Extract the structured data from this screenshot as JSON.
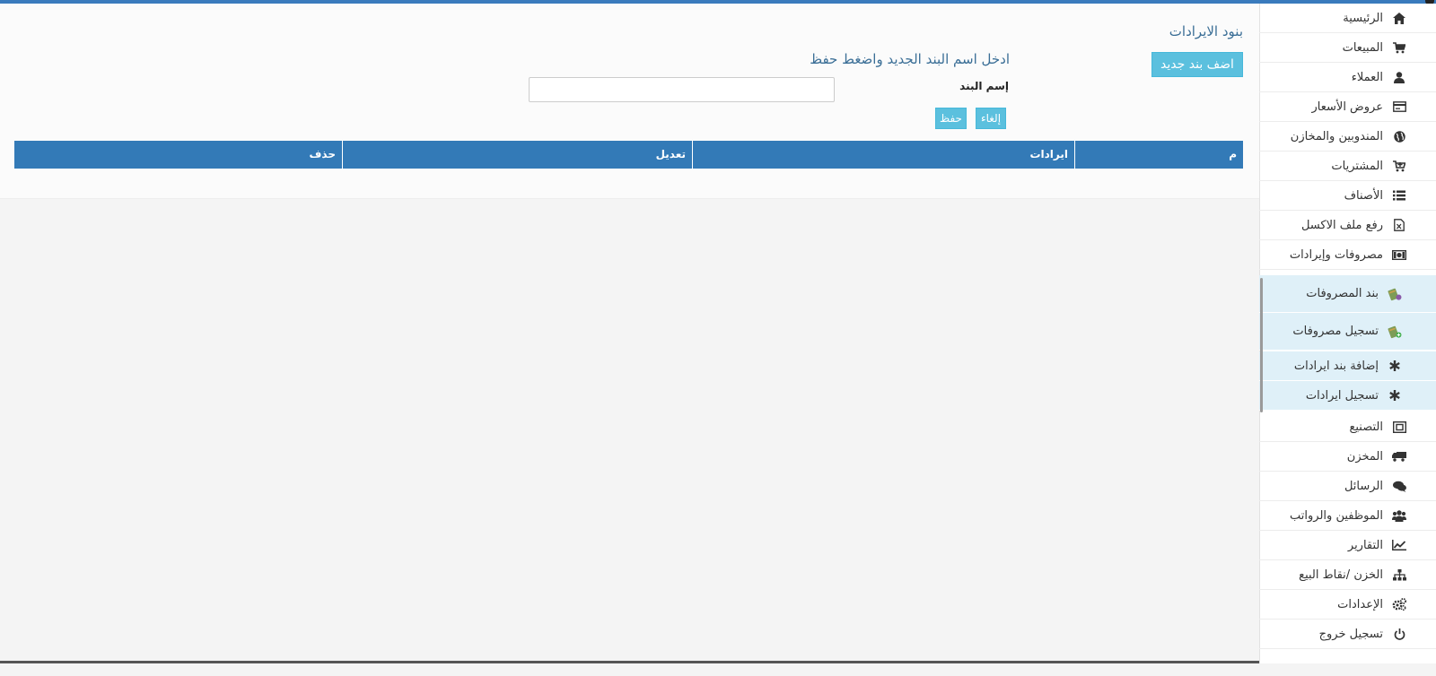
{
  "page": {
    "title": "بنود الايرادات",
    "add_button": "اضف بند جديد",
    "instruction": "ادخل اسم البند الجديد واضغط حفظ",
    "field_label": "إسم البند",
    "field_value": "",
    "cancel_button": "إلغاء",
    "save_button": "حفظ"
  },
  "table": {
    "headers": [
      "م",
      "ايرادات",
      "تعديل",
      "حذف"
    ]
  },
  "sidebar": {
    "items": [
      {
        "label": "الرئيسية",
        "icon": "home-icon"
      },
      {
        "label": "المبيعات",
        "icon": "cart-icon"
      },
      {
        "label": "العملاء",
        "icon": "user-icon"
      },
      {
        "label": "عروض الأسعار",
        "icon": "card-icon"
      },
      {
        "label": "المندوبين والمخازن",
        "icon": "globe-icon"
      },
      {
        "label": "المشتريات",
        "icon": "cart-plus-icon"
      },
      {
        "label": "الأصناف",
        "icon": "list-icon"
      },
      {
        "label": "رفع ملف الاكسل",
        "icon": "excel-file-icon"
      },
      {
        "label": "مصروفات وإيرادات",
        "icon": "money-icon"
      }
    ],
    "sub_items": [
      {
        "label": "بند المصروفات",
        "icon": "money-bag-icon"
      },
      {
        "label": "تسجيل مصروفات",
        "icon": "money-bag-add-icon"
      },
      {
        "label": "إضافة بند ايرادات",
        "icon": "asterisk-icon"
      },
      {
        "label": "تسجيل ايرادات",
        "icon": "asterisk-icon"
      }
    ],
    "items_after": [
      {
        "label": "التصنيع",
        "icon": "manufacture-icon"
      },
      {
        "label": "المخزن",
        "icon": "truck-icon"
      },
      {
        "label": "الرسائل",
        "icon": "chat-icon"
      },
      {
        "label": "الموظفين والرواتب",
        "icon": "users-icon"
      },
      {
        "label": "التقارير",
        "icon": "chart-icon"
      },
      {
        "label": "الخزن /نقاط البيع",
        "icon": "sitemap-icon"
      },
      {
        "label": "الإعدادات",
        "icon": "gears-icon"
      },
      {
        "label": "تسجيل خروج",
        "icon": "power-icon"
      }
    ]
  },
  "colors": {
    "primary": "#337ab7",
    "info": "#5bc0de",
    "title": "#3a6e96",
    "sub_item_bg": "#dff0f8"
  }
}
